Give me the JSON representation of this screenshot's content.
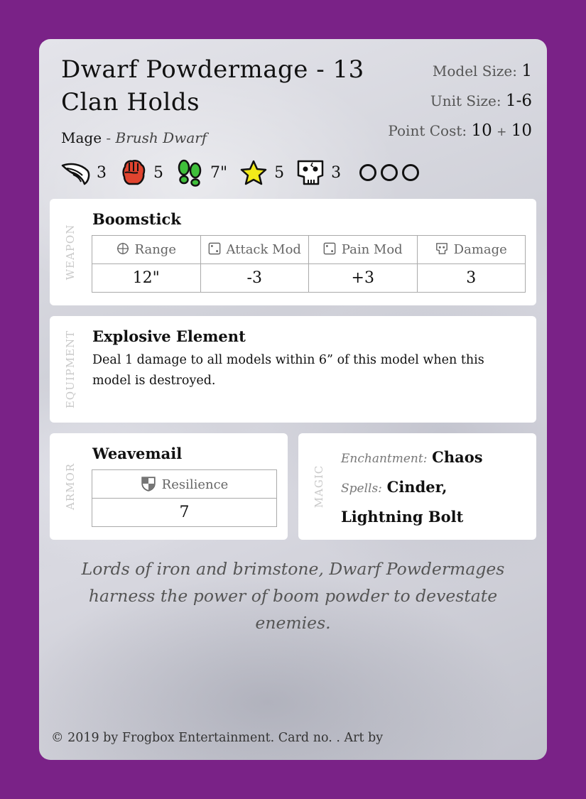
{
  "card": {
    "title_line1": "Dwarf Powdermage - 13",
    "title_line2": "Clan Holds",
    "class": "Mage",
    "separator": "-",
    "race": "Brush Dwarf",
    "model_size_label": "Model Size:",
    "model_size": "1",
    "unit_size_label": "Unit Size:",
    "unit_size": "1-6",
    "point_cost_label": "Point Cost:",
    "point_cost_base": "10",
    "point_cost_plus": "+",
    "point_cost_extra": "10"
  },
  "stats": [
    {
      "icon": "wing-icon",
      "value": "3"
    },
    {
      "icon": "fist-icon",
      "value": "5"
    },
    {
      "icon": "footprints-icon",
      "value": "7\""
    },
    {
      "icon": "star-icon",
      "value": "5"
    },
    {
      "icon": "skull-icon",
      "value": "3"
    }
  ],
  "pips": {
    "count": 3,
    "filled": 0
  },
  "weapon": {
    "section_label": "WEAPON",
    "name": "Boomstick",
    "headers": [
      "Range",
      "Attack Mod",
      "Pain Mod",
      "Damage"
    ],
    "header_icons": [
      "crosshair-icon",
      "die-icon",
      "die-icon",
      "skull-small-icon"
    ],
    "values": [
      "12\"",
      "-3",
      "+3",
      "3"
    ]
  },
  "equipment": {
    "section_label": "EQUIPMENT",
    "name": "Explosive Element",
    "text": "Deal 1 damage to all models within 6” of this model when this model is destroyed."
  },
  "armor": {
    "section_label": "ARMOR",
    "name": "Weavemail",
    "header": "Resilience",
    "header_icon": "shield-icon",
    "value": "7"
  },
  "magic": {
    "section_label": "MAGIC",
    "enchantment_label": "Enchantment:",
    "enchantment": "Chaos",
    "spells_label": "Spells:",
    "spells": "Cinder, Lightning Bolt"
  },
  "flavor_line1": "Lords of iron and brimstone, Dwarf Powdermages",
  "flavor_line2": "harness the power of boom powder to devestate enemies.",
  "footer": "© 2019 by Frogbox Entertainment. Card no. . Art by",
  "colors": {
    "background": "#7a2287",
    "panel": "#ffffff",
    "fist": "#e0442f",
    "footprints": "#3fbf3a",
    "star": "#f2ea1a"
  }
}
